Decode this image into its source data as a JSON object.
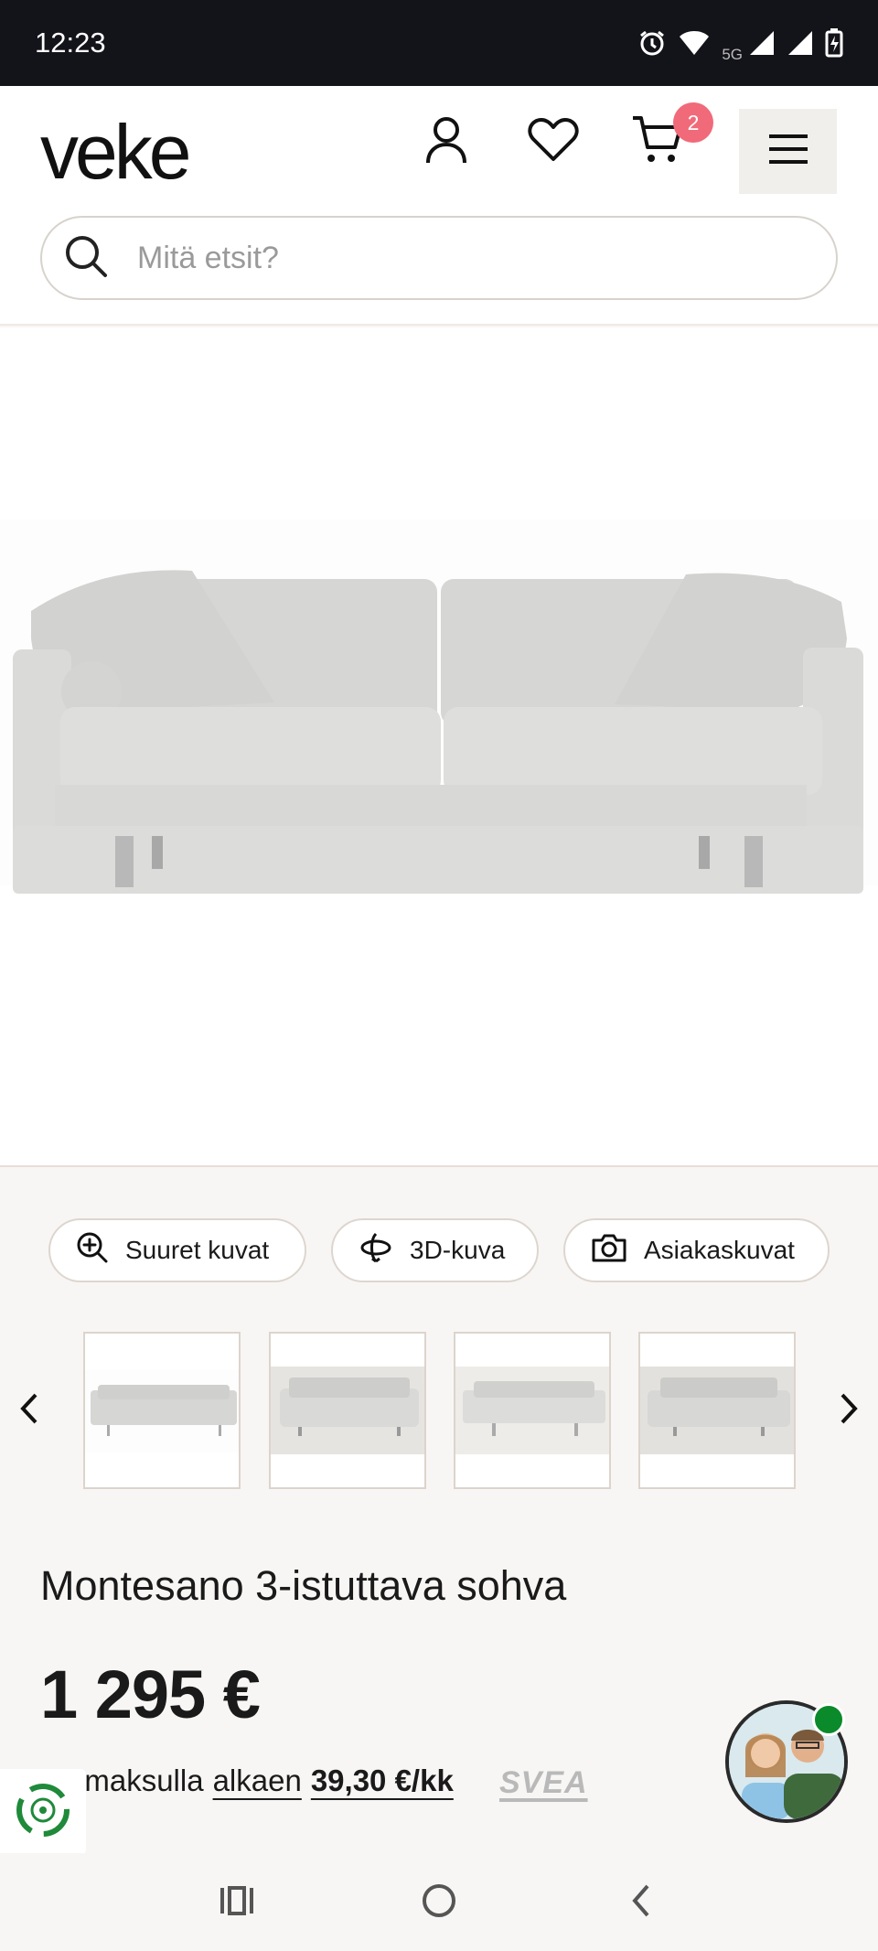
{
  "status_bar": {
    "time": "12:23",
    "network": "5G",
    "icons": [
      "alarm-icon",
      "wifi-icon",
      "signal-icon",
      "signal-icon",
      "battery-charging-icon"
    ]
  },
  "header": {
    "logo": "veke",
    "cart_count": "2",
    "icons": [
      "account-icon",
      "heart-icon",
      "cart-icon",
      "menu-icon"
    ],
    "search": {
      "placeholder": "Mitä etsit?"
    }
  },
  "gallery": {
    "chips": [
      {
        "label": "Suuret kuvat",
        "icon": "zoom-in-icon"
      },
      {
        "label": "3D-kuva",
        "icon": "rotate-3d-icon"
      },
      {
        "label": "Asiakaskuvat",
        "icon": "camera-icon"
      }
    ],
    "thumbnail_count": 4
  },
  "product": {
    "title": "Montesano 3-istuttava sohva",
    "price": "1 295 €",
    "installment_prefix": "ämaksulla",
    "installment_from": "alkaen",
    "installment_amount": "39,30 €/kk",
    "provider": "SVEA"
  },
  "colors": {
    "status_bar_bg": "#13131a",
    "badge": "#f16a7a",
    "page_bg": "#f8f6f4",
    "online": "#0a8a2a",
    "sofa": "#d8d8d6"
  }
}
